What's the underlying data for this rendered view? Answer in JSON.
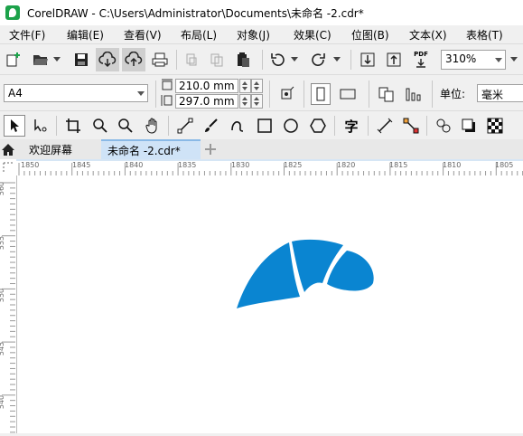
{
  "window": {
    "title": "CorelDRAW - C:\\Users\\Administrator\\Documents\\未命名 -2.cdr*"
  },
  "menu": [
    {
      "label": "文件(F)"
    },
    {
      "label": "编辑(E)"
    },
    {
      "label": "查看(V)"
    },
    {
      "label": "布局(L)"
    },
    {
      "label": "对象(J)"
    },
    {
      "label": "效果(C)"
    },
    {
      "label": "位图(B)"
    },
    {
      "label": "文本(X)"
    },
    {
      "label": "表格(T)"
    }
  ],
  "toolbar": {
    "zoom_value": "310%",
    "pdf_label": "PDF"
  },
  "property_bar": {
    "page_size": "A4",
    "width": "210.0 mm",
    "height": "297.0 mm",
    "units_label": "单位:",
    "units_value": "毫米"
  },
  "toolbox": {
    "text_tool_glyph": "字"
  },
  "tabs": [
    {
      "label": "欢迎屏幕",
      "active": false
    },
    {
      "label": "未命名 -2.cdr*",
      "active": true
    }
  ],
  "ruler": {
    "horizontal": [
      "1850",
      "1845",
      "1840",
      "1835",
      "1830",
      "1825",
      "1820",
      "1815",
      "1810",
      "1805"
    ],
    "vertical": [
      "560",
      "555",
      "550",
      "545",
      "540"
    ]
  },
  "colors": {
    "shape_fill": "#0a85d1",
    "accent_green": "#1ca24a",
    "active_tab": "#cfe3f7"
  }
}
